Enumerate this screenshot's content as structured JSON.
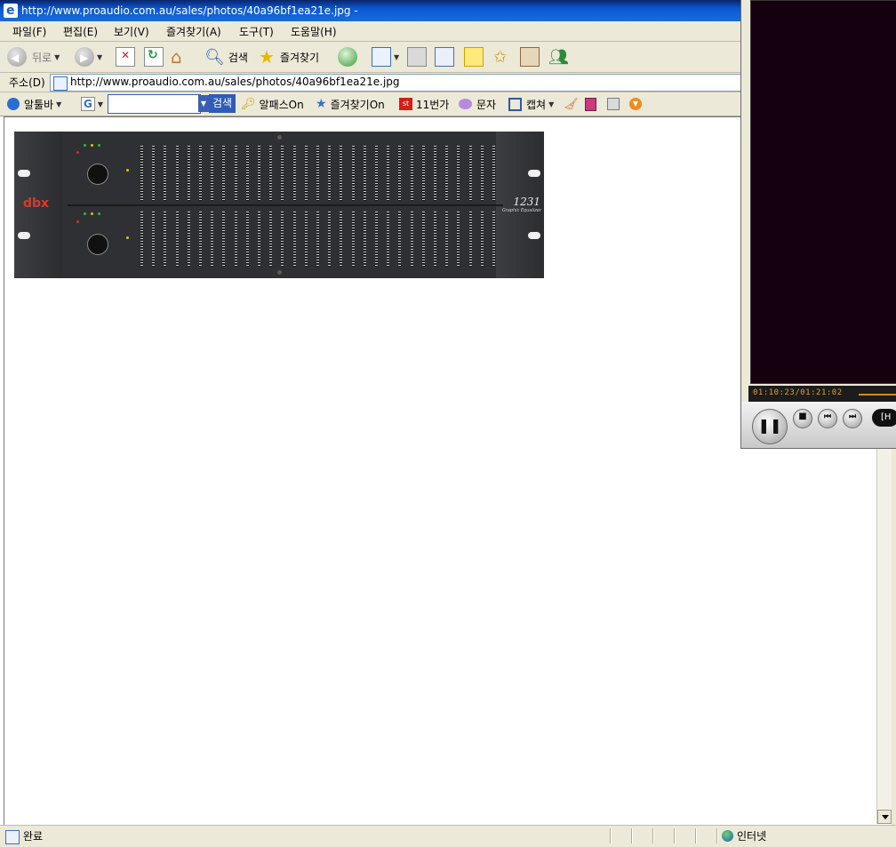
{
  "window": {
    "title": "http://www.proaudio.com.au/sales/photos/40a96bf1ea21e.jpg -"
  },
  "menu": {
    "file": "파일(F)",
    "edit": "편집(E)",
    "view": "보기(V)",
    "favorites": "즐겨찾기(A)",
    "tools": "도구(T)",
    "help": "도움말(H)"
  },
  "toolbar": {
    "back_label": "뒤로",
    "search_label": "검색",
    "favorites_label": "즐겨찾기"
  },
  "address": {
    "label": "주소(D)",
    "url": "http://www.proaudio.com.au/sales/photos/40a96bf1ea21e.jpg"
  },
  "linkbar": {
    "altoolbar": "알툴바",
    "search_button": "검색",
    "alpass": "알패스On",
    "favorites_on": "즐겨찾기On",
    "eleven_st": "11번가",
    "sms": "문자",
    "capture": "캡쳐"
  },
  "image": {
    "brand": "dbx",
    "model": "1231",
    "subtitle": "Graphic Equalizer"
  },
  "status": {
    "text": "완료",
    "zone": "인터넷"
  },
  "player": {
    "time": "01:10:23/01:21:02",
    "mode_label": "[H"
  },
  "icons": {
    "back": "back-arrow-icon",
    "forward": "forward-arrow-icon",
    "stop": "stop-icon",
    "refresh": "refresh-icon",
    "home": "home-icon",
    "search": "magnifier-icon",
    "favorites": "star-icon",
    "history": "history-icon",
    "mail": "mail-icon",
    "print": "printer-icon",
    "edit": "edit-icon",
    "messenger": "messenger-icon",
    "ie": "ie-logo-icon",
    "globe": "globe-icon"
  }
}
